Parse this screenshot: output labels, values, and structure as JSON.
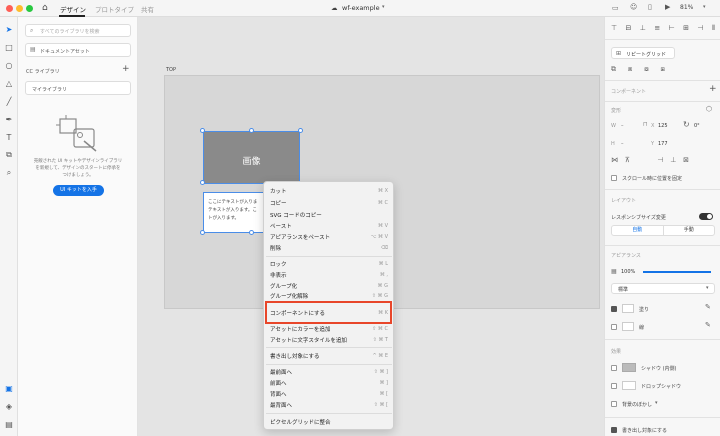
{
  "titlebar": {
    "tabs": [
      "デザイン",
      "プロトタイプ",
      "共有"
    ],
    "doc_name": "wf-example",
    "zoom": "81%"
  },
  "library": {
    "search_placeholder": "すべてのライブラリを検索",
    "doc_assets": "ドキュメントアセット",
    "cc_libraries": "CC ライブラリ",
    "my_library": "マイライブラリ",
    "empty_text_1": "売飯された UI キットやデザインライブラリ",
    "empty_text_2": "を新規して、デザインのスタートに停承を",
    "empty_text_3": "つけましょう。",
    "ui_kit_button": "UI キットを入手"
  },
  "canvas": {
    "artboard_name": "TOP",
    "image_placeholder": "画像",
    "body_text_1": "ここにテキストが入りま",
    "body_text_2": "テキストが入ります。こ",
    "body_text_3": "トが入ります。"
  },
  "context_menu": {
    "items": [
      {
        "label": "カット",
        "shortcut": "⌘ X"
      },
      {
        "label": "コピー",
        "shortcut": "⌘ C"
      },
      {
        "label": "SVG コードのコピー",
        "shortcut": ""
      },
      {
        "label": "ペースト",
        "shortcut": "⌘ V"
      },
      {
        "label": "アピアランスをペースト",
        "shortcut": "⌥ ⌘ V"
      },
      {
        "label": "削除",
        "shortcut": "⌫"
      },
      {
        "label": "ロック",
        "shortcut": "⌘ L"
      },
      {
        "label": "非表示",
        "shortcut": "⌘ ,"
      },
      {
        "label": "グループ化",
        "shortcut": "⌘ G"
      },
      {
        "label": "グループ化解除",
        "shortcut": "⇧ ⌘ G"
      },
      {
        "label": "コンポーネントにする",
        "shortcut": "⌘ K"
      },
      {
        "label": "アセットにカラーを追加",
        "shortcut": "⇧ ⌘ C"
      },
      {
        "label": "アセットに文字スタイルを追加",
        "shortcut": "⇧ ⌘ T"
      },
      {
        "label": "書き出し対象にする",
        "shortcut": "^ ⌘ E"
      },
      {
        "label": "最前面へ",
        "shortcut": "⇧ ⌘ ]"
      },
      {
        "label": "前面へ",
        "shortcut": "⌘ ]"
      },
      {
        "label": "背面へ",
        "shortcut": "⌘ ["
      },
      {
        "label": "最背面へ",
        "shortcut": "⇧ ⌘ ["
      },
      {
        "label": "ピクセルグリッドに整合",
        "shortcut": ""
      }
    ],
    "highlight_color": "#e8462a"
  },
  "right": {
    "repeat_grid": "リピートグリッド",
    "component": "コンポーネント",
    "transform": "変形",
    "w_label": "W",
    "w_value": "–",
    "h_label": "H",
    "h_value": "–",
    "x_label": "X",
    "x_value": "125",
    "y_label": "Y",
    "y_value": "177",
    "scroll_fix": "スクロール時に位置を固定",
    "layout": "レイアウト",
    "responsive": "レスポンシブサイズ変更",
    "auto": "自動",
    "manual": "手動",
    "appearance": "アピアランス",
    "opacity": "100%",
    "blend": "標準",
    "fill": "塗り",
    "border": "線",
    "effects": "効果",
    "inner_shadow": "シャドウ (内側)",
    "drop_shadow": "ドロップシャドウ",
    "bg_blur": "背景のぼかし",
    "export": "書き出し対象にする"
  },
  "colors": {
    "accent": "#1473e6",
    "selection": "#4a8de8"
  }
}
